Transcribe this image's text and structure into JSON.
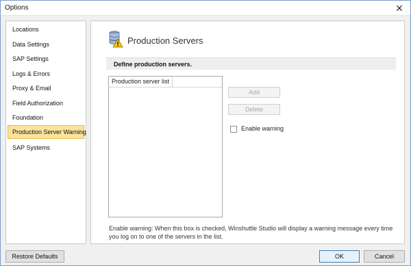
{
  "window": {
    "title": "Options"
  },
  "sidebar": {
    "items": [
      {
        "label": "Locations",
        "selected": false
      },
      {
        "label": "Data Settings",
        "selected": false
      },
      {
        "label": "SAP Settings",
        "selected": false
      },
      {
        "label": "Logs & Errors",
        "selected": false
      },
      {
        "label": "Proxy & Email",
        "selected": false
      },
      {
        "label": "Field Authorization",
        "selected": false
      },
      {
        "label": "Foundation",
        "selected": false
      },
      {
        "label": "Production Server Warning",
        "selected": true
      },
      {
        "label": "SAP Systems",
        "selected": false
      }
    ]
  },
  "content": {
    "page_title": "Production Servers",
    "page_icon": "database-warning-icon",
    "section_label": "Define production servers.",
    "list_header": "Production server list",
    "add_label": "Add",
    "delete_label": "Delete",
    "enable_warning_label": "Enable warning",
    "enable_warning_checked": false,
    "footnote": "Enable warning: When this box is checked, Winshuttle Studio will display a warning message every time you log on to one of the servers in the list."
  },
  "footer": {
    "restore_label": "Restore Defaults",
    "ok_label": "OK",
    "cancel_label": "Cancel"
  },
  "colors": {
    "selected_item_bg": "#fbe39a",
    "selected_item_border": "#e2b94e",
    "section_bar_bg": "#eeeeee",
    "ok_button_border": "#3c7fb1"
  }
}
